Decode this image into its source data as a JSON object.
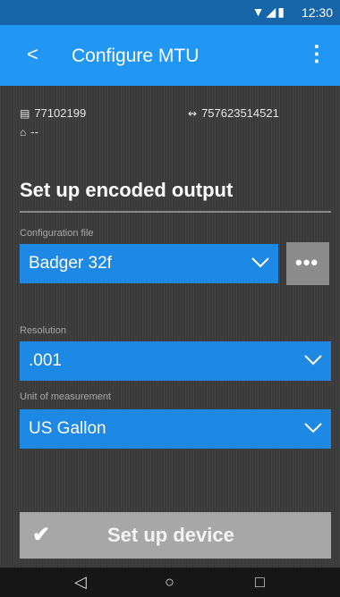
{
  "status_bar": {
    "time": "12:30",
    "icons": "▼◢▮"
  },
  "app_bar": {
    "back": "<",
    "title": "Configure MTU",
    "more": "⋮"
  },
  "info": {
    "id1": "77102199",
    "id2": "757623514521",
    "home_value": "--"
  },
  "section": {
    "title": "Set up encoded output"
  },
  "config_file": {
    "label": "Configuration file",
    "value": "Badger 32f",
    "more": "•••"
  },
  "resolution": {
    "label": "Resolution",
    "value": ".001"
  },
  "unit": {
    "label": "Unit of measurement",
    "value": "US Gallon"
  },
  "setup_button": {
    "check": "✔",
    "label": "Set up device"
  },
  "nav": {
    "back": "◁",
    "home": "○",
    "recents": "□"
  },
  "colors": {
    "accent": "#2196f3",
    "field": "#1e88e5",
    "status_bar": "#1565a8"
  }
}
